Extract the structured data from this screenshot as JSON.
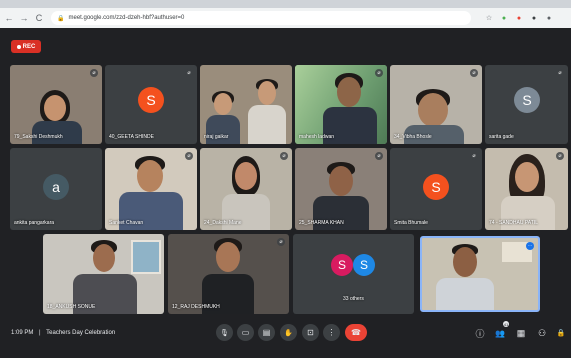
{
  "browser": {
    "url": "meet.google.com/zzd-dzeh-hbf?authuser=0",
    "back_icon": "←",
    "forward_icon": "→",
    "reload_icon": "C"
  },
  "recording": {
    "label": "REC",
    "color": "#d93025"
  },
  "tiles": [
    {
      "name": "79_Sakshi Deshmukh",
      "type": "video"
    },
    {
      "name": "40_GEETA SHINDE",
      "type": "avatar",
      "initial": "S",
      "avatar_color": "#f4511e"
    },
    {
      "name": "niraj gaikar",
      "type": "video"
    },
    {
      "name": "mahesh ladwan",
      "type": "video"
    },
    {
      "name": "34_Vibha Bhosle",
      "type": "video"
    },
    {
      "name": "sarita gade",
      "type": "avatar",
      "initial": "S",
      "avatar_color": "#7d8a96"
    },
    {
      "name": "ankita pangarkara",
      "type": "avatar",
      "initial": "a",
      "avatar_color": "#455a64"
    },
    {
      "name": "Sanket Chavan",
      "type": "video"
    },
    {
      "name": "24_Dakshi Mane",
      "type": "video"
    },
    {
      "name": "25_SHARMA KHAN",
      "type": "video"
    },
    {
      "name": "Smita Bhumale",
      "type": "avatar",
      "initial": "S",
      "avatar_color": "#f4511e"
    },
    {
      "name": "74 - SANDHAU PATIL",
      "type": "video"
    },
    {
      "name": "18_ANKUSH SONUE",
      "type": "video"
    },
    {
      "name": "12_RAJ DESHMUKH",
      "type": "video"
    },
    {
      "name": "33 others",
      "type": "others",
      "initials": [
        "S",
        "S"
      ],
      "colors": [
        "#d81b60",
        "#1e88e5"
      ]
    },
    {
      "name": "",
      "type": "self"
    }
  ],
  "meeting": {
    "time": "1:09 PM",
    "separator": "|",
    "title": "Teachers Day Celebration"
  },
  "controls": {
    "mic_icon": "🎙",
    "camera_icon": "▭",
    "captions_icon": "▤",
    "raise_hand_icon": "✋",
    "present_icon": "⊡",
    "more_icon": "⋮",
    "end_call_icon": "☎",
    "end_call_color": "#ea4335"
  },
  "right_controls": {
    "info_icon": "ⓘ",
    "people_icon": "👥",
    "people_count": "41",
    "chat_icon": "▦",
    "activities_icon": "⚇",
    "lock_icon": "🔒"
  }
}
